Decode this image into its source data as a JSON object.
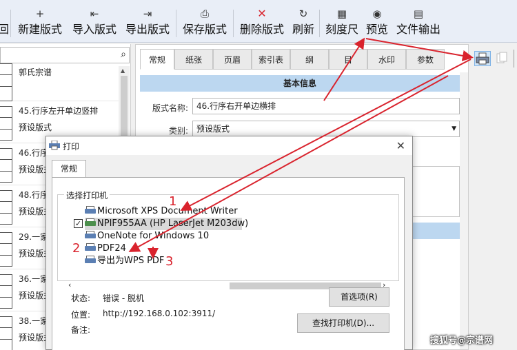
{
  "toolbar": {
    "buttons": [
      {
        "label": "回",
        "icon": "return-icon",
        "glyph": ""
      },
      {
        "label": "新建版式",
        "icon": "plus-icon",
        "glyph": "+"
      },
      {
        "label": "导入版式",
        "icon": "import-icon",
        "glyph": "⇤"
      },
      {
        "label": "导出版式",
        "icon": "export-icon",
        "glyph": "⇥"
      },
      {
        "label": "保存版式",
        "icon": "save-icon",
        "glyph": "⎙"
      },
      {
        "label": "删除版式",
        "icon": "delete-icon",
        "glyph": "✕"
      },
      {
        "label": "刷新",
        "icon": "refresh-icon",
        "glyph": "↻"
      },
      {
        "label": "刻度尺",
        "icon": "ruler-icon",
        "glyph": "▦"
      },
      {
        "label": "预览",
        "icon": "eye-icon",
        "glyph": "◉"
      },
      {
        "label": "文件输出",
        "icon": "file-output-icon",
        "glyph": "▤"
      }
    ]
  },
  "left_list": {
    "items": [
      {
        "title": "郭氏宗谱",
        "subtitle": ""
      },
      {
        "title": "45.行序左开单边竖排",
        "subtitle": "预设版式"
      },
      {
        "title": "46.行序",
        "subtitle": "预设版式"
      },
      {
        "title": "48.行序",
        "subtitle": "预设版式"
      },
      {
        "title": "29.一家",
        "subtitle": "预设版式"
      },
      {
        "title": "36.一家",
        "subtitle": "预设版式"
      },
      {
        "title": "38.一家",
        "subtitle": "预设版式"
      }
    ]
  },
  "form": {
    "tabs": [
      "常规",
      "纸张",
      "页眉",
      "索引表",
      "纲",
      "目",
      "水印",
      "参数"
    ],
    "active_tab": "常规",
    "section_title": "基本信息",
    "layout_name_label": "版式名称:",
    "layout_name_value": "46.行序右开单边横排",
    "category_label": "类别:",
    "category_value": "预设版式"
  },
  "dialog": {
    "title": "打印",
    "tab": "常规",
    "group_label": "选择打印机",
    "printers": [
      {
        "name": "Microsoft XPS Document Writer",
        "selected": false,
        "checked": false
      },
      {
        "name": "NPIF955AA (HP LaserJet M203dw)",
        "selected": true,
        "checked": true
      },
      {
        "name": "OneNote for Windows 10",
        "selected": false,
        "checked": false
      },
      {
        "name": "PDF24",
        "selected": false,
        "checked": false
      },
      {
        "name": "导出为WPS PDF",
        "selected": false,
        "checked": false
      }
    ],
    "status_label": "状态:",
    "status_value": "错误 - 脱机",
    "location_label": "位置:",
    "location_value": "http://192.168.0.102:3911/",
    "comment_label": "备注:",
    "comment_value": "",
    "preferences_button": "首选项(R)",
    "find_printer_button": "查找打印机(D)..."
  },
  "annotations": {
    "numbers": [
      "1",
      "2",
      "3"
    ],
    "color": "#d9232d"
  },
  "watermark": "搜狐号@宗谱网",
  "colors": {
    "toolbar_bg": "#e9eef7",
    "section_header_bg": "#bcd7f0",
    "selection_gray": "#d9d9d9",
    "annotation_red": "#d9232d"
  }
}
